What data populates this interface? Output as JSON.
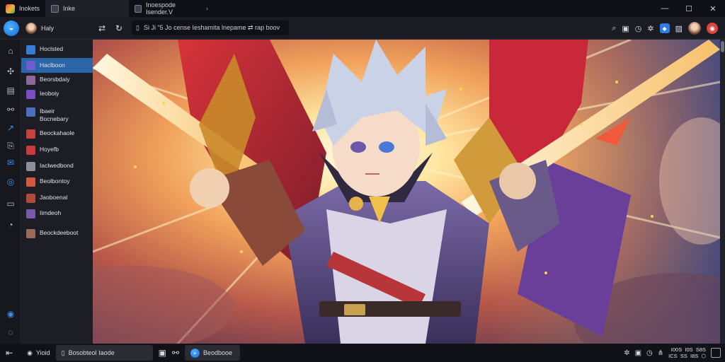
{
  "window": {
    "tabs": [
      {
        "label": "Inokets"
      },
      {
        "label": "Inke"
      },
      {
        "label": "Inoespode Isender.V"
      }
    ],
    "controls": {
      "minimize": "—",
      "maximize": "☐",
      "close": "✕"
    }
  },
  "toolbar": {
    "user_name": "Haly",
    "address": "Si  Ji   “5 Jo cense Ieshamita  lnepame  ⇄ rap   boov"
  },
  "sidebar": {
    "items": [
      {
        "label": "Hoclsted",
        "color": "#3a7bd5"
      },
      {
        "label": "Haclboon",
        "color": "#6d5fd0",
        "active": true
      },
      {
        "label": "Beorsbdaiy",
        "color": "#8b6a9a"
      },
      {
        "label": "Ieoboiy",
        "color": "#7b4cc4"
      },
      {
        "label": "Ibaeir Bocnebary",
        "color": "#4d6fc2"
      },
      {
        "label": "Beockahaole",
        "color": "#c4443a"
      },
      {
        "label": "Hoyefb",
        "color": "#c93b3b"
      },
      {
        "label": "Iaclwedbond",
        "color": "#8a8f9a"
      },
      {
        "label": "Beolbontoy",
        "color": "#d35a3a"
      },
      {
        "label": "Jaoboenal",
        "color": "#b04a3a"
      },
      {
        "label": "Iimdeoh",
        "color": "#7a5aa8"
      },
      {
        "label": "Beockdeeboot",
        "color": "#9a6a5a"
      }
    ]
  },
  "statusbar": {
    "left_label": "Yioid",
    "box_label": "Bosobteol Iaode",
    "app_label": "Beodbooe",
    "clock_top": "I00S  I0S  S8S",
    "clock_bottom": "ICS  SS  I8S  ⬡"
  },
  "colors": {
    "accent": "#2c65a8",
    "brand_blue": "#2f7ee6",
    "close_red": "#e0443a"
  }
}
